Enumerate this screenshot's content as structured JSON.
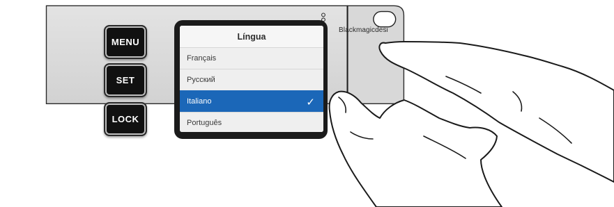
{
  "device": {
    "buttons": [
      {
        "id": "menu",
        "label": "MENU"
      },
      {
        "id": "set",
        "label": "SET"
      },
      {
        "id": "lock",
        "label": "LOCK"
      }
    ],
    "brand": "Blackmagicdesi"
  },
  "screen": {
    "title": "Língua",
    "items": [
      {
        "label": "Français",
        "selected": false
      },
      {
        "label": "Русский",
        "selected": false
      },
      {
        "label": "Italiano",
        "selected": true
      },
      {
        "label": "Português",
        "selected": false
      }
    ],
    "check_icon": "checkmark-icon"
  },
  "colors": {
    "panel": "#dcdcdc",
    "selection": "#1b67b8",
    "button_face": "#111111"
  }
}
